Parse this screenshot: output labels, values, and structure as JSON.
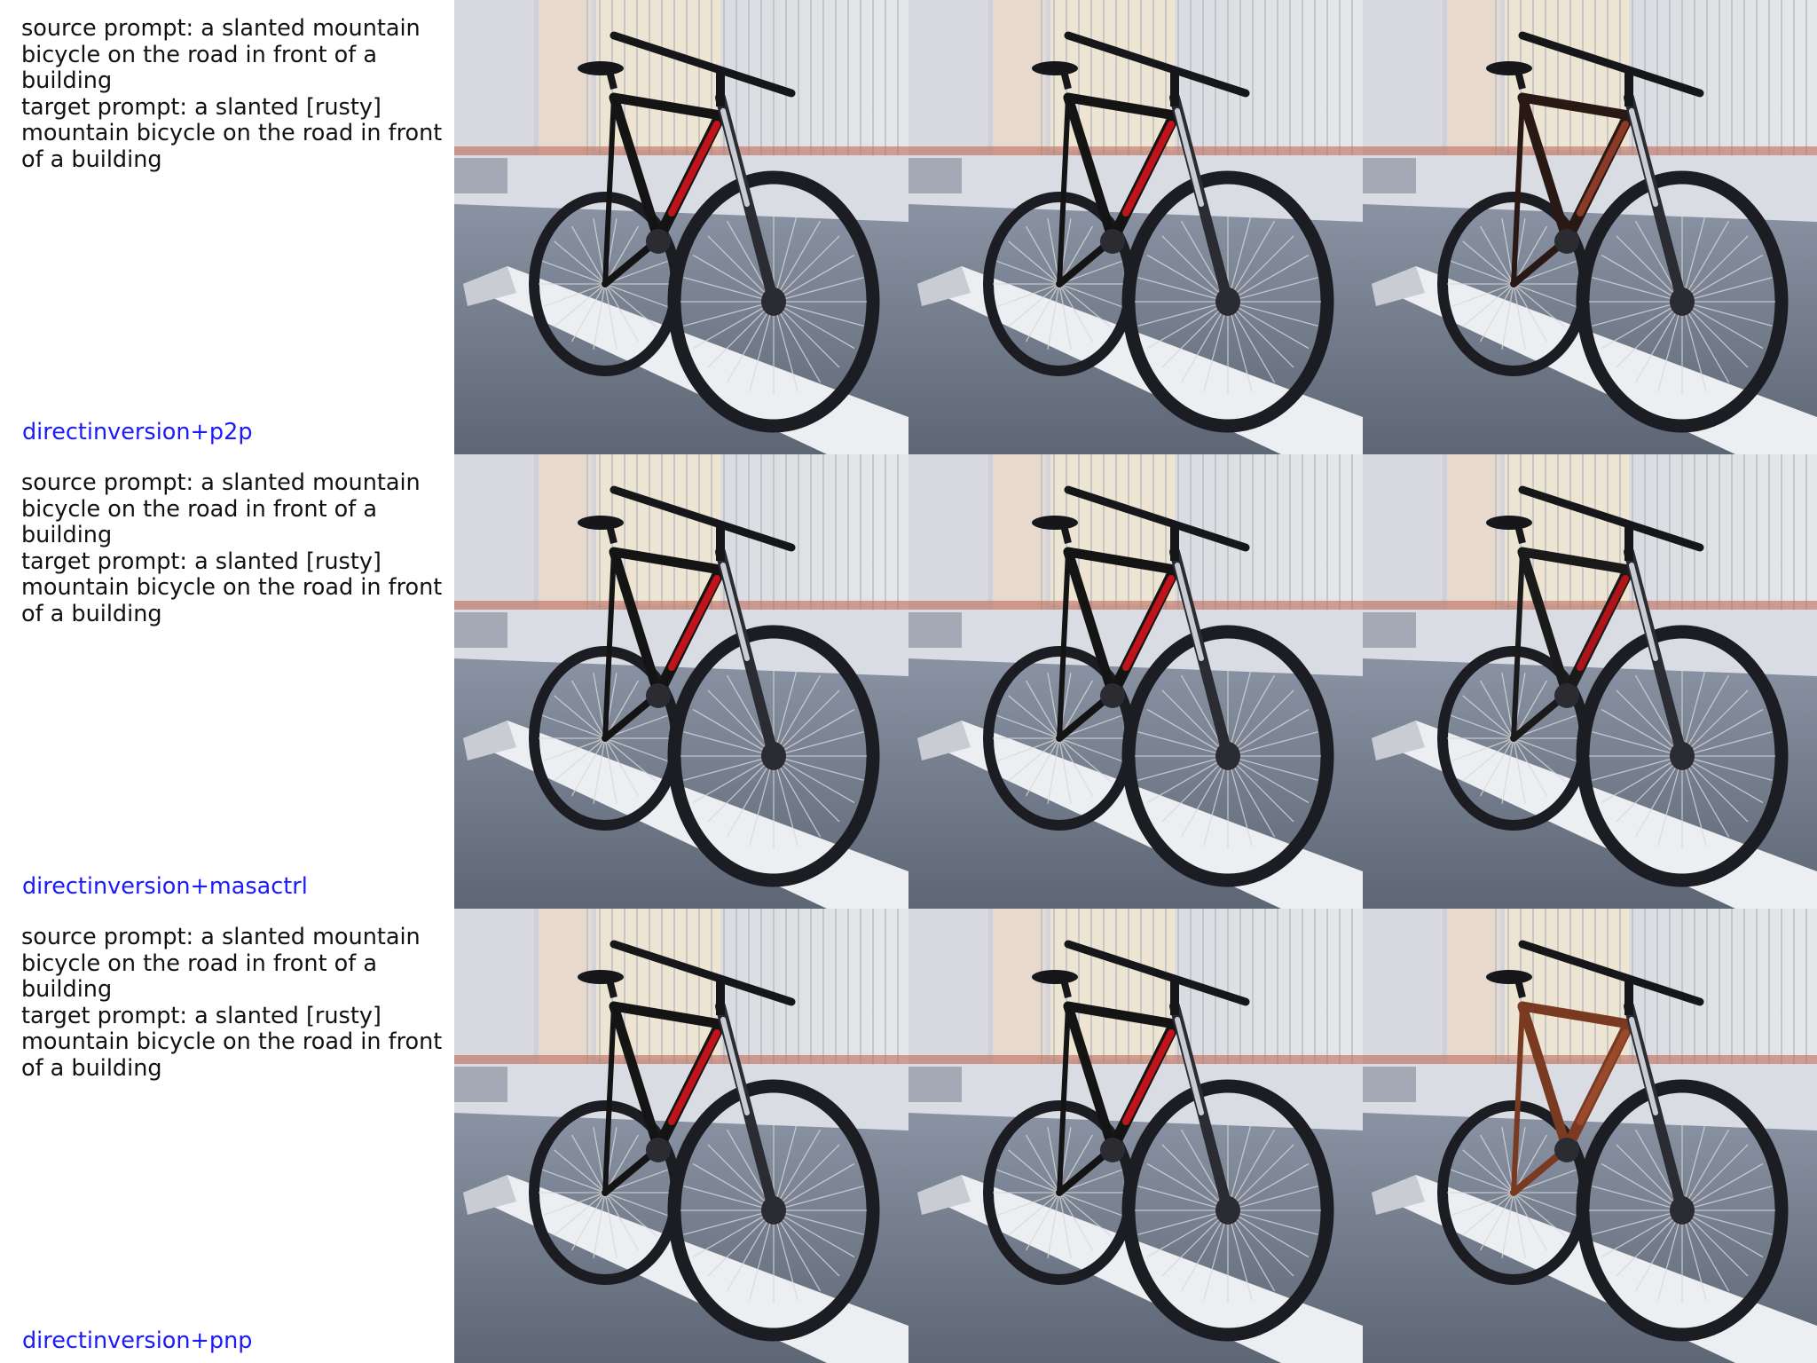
{
  "rows": [
    {
      "prompt_text": "source prompt: a slanted mountain\nbicycle on the road in front of a\nbuilding\ntarget prompt: a slanted [rusty]\nmountain bicycle on the road in front\nof a building",
      "method": "directinversion+p2p",
      "frame_colors": [
        "#141414",
        "#141414",
        "#2a1815"
      ],
      "accent_colors": [
        "#c0141a",
        "#c0141a",
        "#8a3a26"
      ]
    },
    {
      "prompt_text": "source prompt: a slanted mountain\nbicycle on the road in front of a\nbuilding\ntarget prompt: a slanted [rusty]\nmountain bicycle on the road in front\nof a building",
      "method": "directinversion+masactrl",
      "frame_colors": [
        "#141414",
        "#141414",
        "#1a1a1a"
      ],
      "accent_colors": [
        "#c0141a",
        "#c0141a",
        "#b01418"
      ]
    },
    {
      "prompt_text": "source prompt: a slanted mountain\nbicycle on the road in front of a\nbuilding\ntarget prompt: a slanted [rusty]\nmountain bicycle on the road in front\nof a building",
      "method": "directinversion+pnp",
      "frame_colors": [
        "#141414",
        "#141414",
        "#7a3a22"
      ],
      "accent_colors": [
        "#c0141a",
        "#c0141a",
        "#9a4a2a"
      ]
    }
  ]
}
